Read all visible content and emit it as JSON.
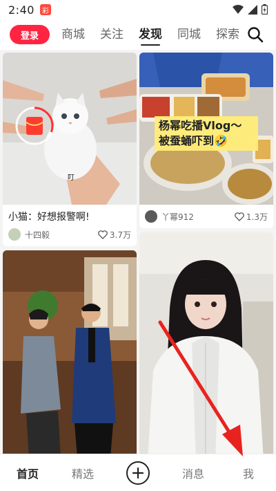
{
  "status": {
    "time": "2:40",
    "app_badge": "彩",
    "icons": [
      "wifi-icon",
      "signal-icon",
      "battery-icon"
    ]
  },
  "topnav": {
    "login": "登录",
    "tabs": [
      "商城",
      "关注",
      "发现",
      "同城",
      "探索"
    ],
    "active_tab": "发现",
    "search_icon": "search-icon"
  },
  "feed": {
    "cards": [
      {
        "column": "left",
        "caption": "小猫：好想报警啊!",
        "author": "十四毅",
        "likes": "3.7万",
        "overlay_text": "叮",
        "thumb_desc_icon": "red-envelope-icon"
      },
      {
        "column": "right",
        "caption": "",
        "author": "丫幂912",
        "likes": "1.3万",
        "overlay_text": "杨幂吃播Vlog～\n被蚕蛹吓到🤣"
      },
      {
        "column": "left",
        "caption": "",
        "author": "",
        "likes": ""
      },
      {
        "column": "right",
        "caption": "",
        "author": "",
        "likes": ""
      }
    ]
  },
  "bottomnav": {
    "items": [
      "首页",
      "精选",
      "",
      "消息",
      "我"
    ],
    "active": "首页"
  },
  "colors": {
    "accent": "#ff2442",
    "annotation": "#e8231f"
  }
}
